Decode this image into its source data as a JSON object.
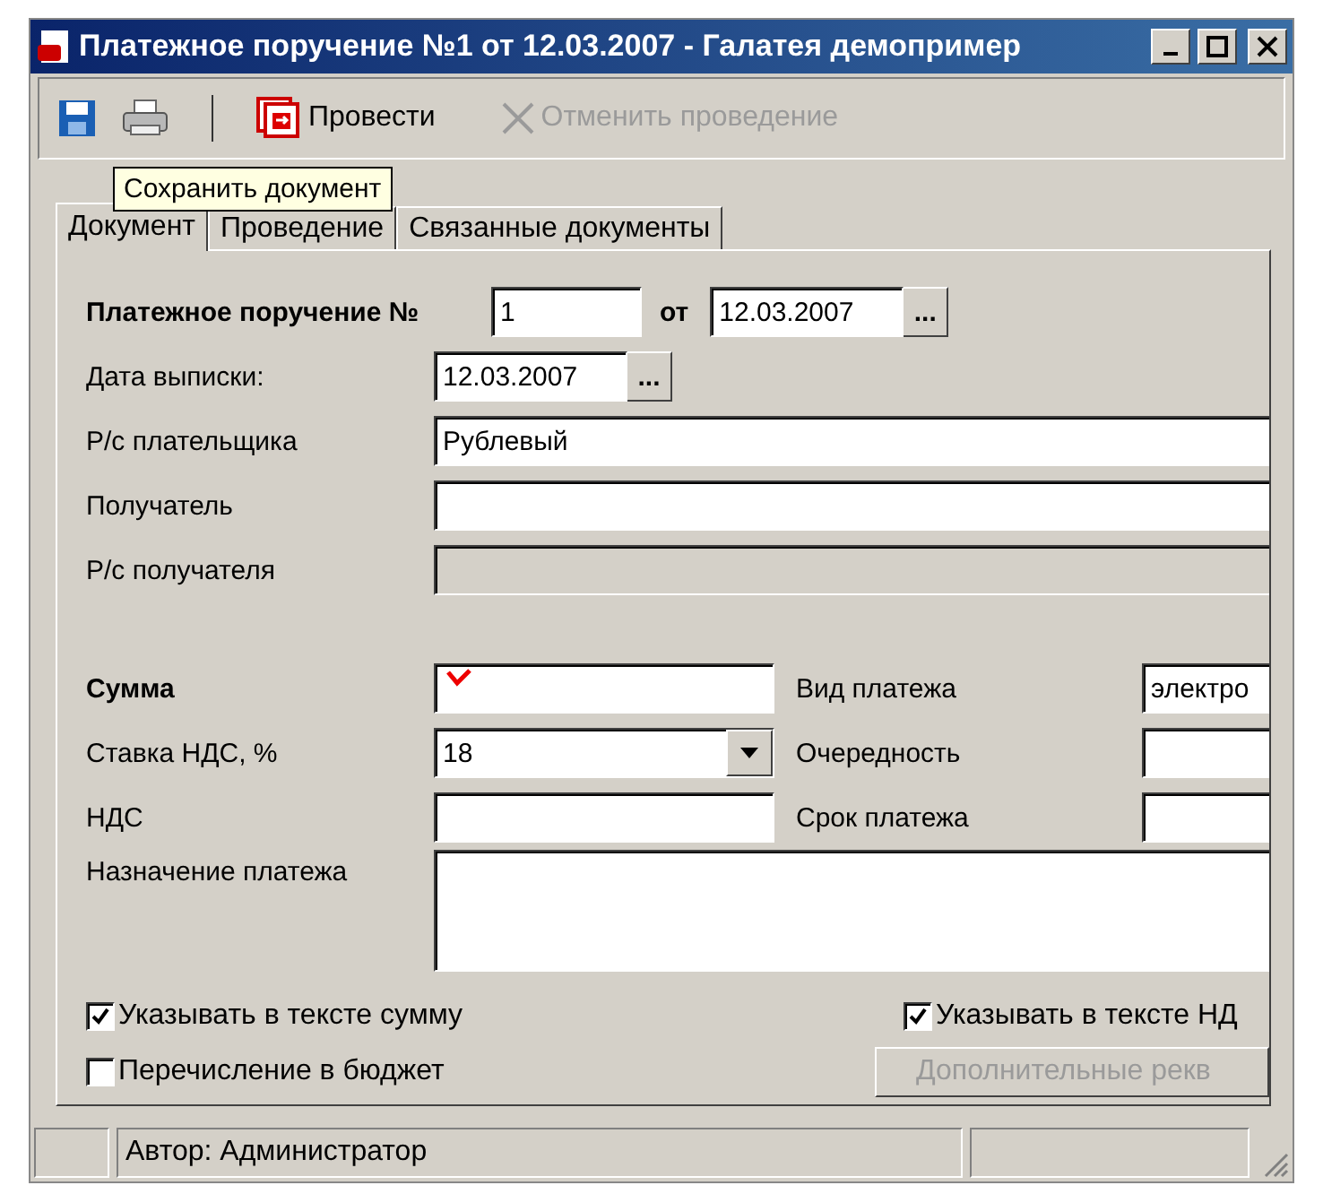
{
  "window": {
    "title": "Платежное поручение №1 от 12.03.2007 - Галатея демопример"
  },
  "toolbar": [
    {
      "kind": "save"
    },
    {
      "kind": "print"
    },
    {
      "kind": "post",
      "label": "Провести",
      "disabled": false
    },
    {
      "kind": "cancel",
      "label": "Отменить проведение",
      "disabled": true
    }
  ],
  "tooltip": "Сохранить документ",
  "tabs": [
    {
      "label": "Документ",
      "selected": true
    },
    {
      "label": "Проведение",
      "selected": false
    },
    {
      "label": "Связанные документы",
      "selected": false
    }
  ],
  "header": {
    "label": "Платежное поручение №",
    "number": "1",
    "from_label": "от",
    "date": "12.03.2007",
    "picker": "..."
  },
  "fields": [
    {
      "kind": "date",
      "label": "Дата выписки:",
      "value": "12.03.2007",
      "picker": "..."
    },
    {
      "kind": "text",
      "label": "Р/с плательщика",
      "value": "Рублевый",
      "disabled": false
    },
    {
      "kind": "text",
      "label": "Получатель",
      "disabled": false
    },
    {
      "kind": "text",
      "label": "Р/с получателя",
      "disabled": true
    }
  ],
  "amounts": [
    {
      "left": {
        "kind": "text",
        "label": "Сумма",
        "bold": true,
        "required": true
      },
      "right": {
        "label": "Вид платежа",
        "value": "электро"
      }
    },
    {
      "left": {
        "kind": "combo",
        "label": "Ставка НДС, %",
        "value": "18",
        "bold": false,
        "required": false
      },
      "right": {
        "label": "Очередность"
      }
    },
    {
      "left": {
        "kind": "text",
        "label": "НДС",
        "bold": false,
        "required": false
      },
      "right": {
        "label": "Срок платежа"
      }
    }
  ],
  "purpose": {
    "label": "Назначение платежа"
  },
  "checkboxes": [
    {
      "label": "Указывать в тексте сумму",
      "checked": true
    },
    {
      "label": "Указывать в тексте НД",
      "checked": true
    },
    {
      "label": "Перечисление в бюджет",
      "checked": false
    }
  ],
  "extra_button": {
    "label": "Дополнительные рекв",
    "disabled": true
  },
  "status_bar": {
    "text": "Автор: Администратор"
  }
}
